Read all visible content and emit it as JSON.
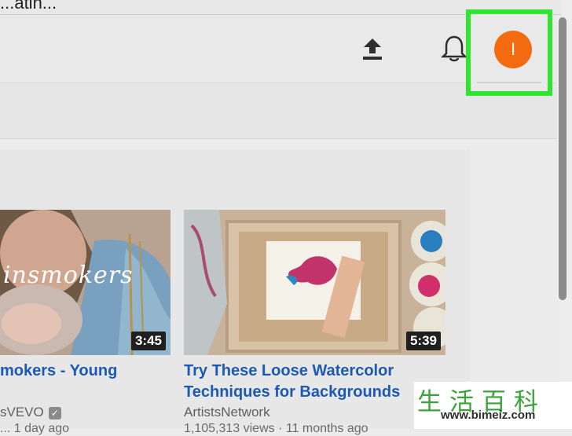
{
  "browser": {
    "url_text": "...atin..."
  },
  "header": {
    "upload_icon": "upload-icon",
    "notifications_icon": "bell-icon",
    "avatar_initial": "I",
    "avatar_color": "#f36a10",
    "highlight_color": "#2fe52f"
  },
  "videos": [
    {
      "thumbnail_text": "insmokers",
      "duration": "3:45",
      "title": "mokers - Young",
      "channel": "sVEVO",
      "verified": true,
      "meta": "... 1 day ago"
    },
    {
      "duration": "5:39",
      "title": "Try These Loose Watercolor Techniques for Backgrounds",
      "channel": "ArtistsNetwork",
      "meta": "1,105,313 views · 11 months ago"
    }
  ],
  "watermark": {
    "chinese": "生活百科",
    "url": "www.bimeiz.com"
  }
}
